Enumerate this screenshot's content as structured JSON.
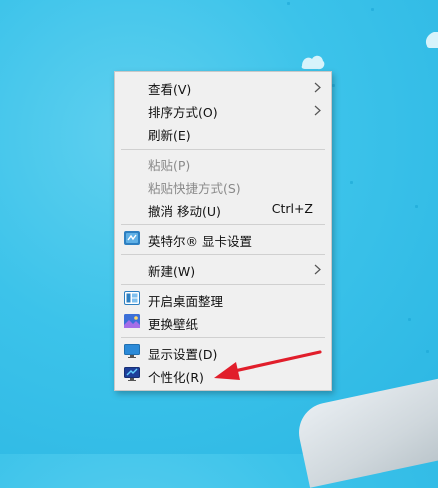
{
  "menu": {
    "view": "查看(V)",
    "sort": "排序方式(O)",
    "refresh": "刷新(E)",
    "paste": "粘贴(P)",
    "paste_shortcut": "粘贴快捷方式(S)",
    "undo_move": "撤消 移动(U)",
    "undo_shortcut": "Ctrl+Z",
    "intel_graphics": "英特尔® 显卡设置",
    "new": "新建(W)",
    "open_desktop_organize": "开启桌面整理",
    "change_wallpaper": "更换壁纸",
    "display_settings": "显示设置(D)",
    "personalize": "个性化(R)"
  },
  "icons": {
    "intel": "intel-graphics-icon",
    "organize": "desktop-organize-icon",
    "wallpaper": "wallpaper-icon",
    "display": "display-settings-icon",
    "personalize": "personalize-icon"
  },
  "colors": {
    "desktop": "#3cc3ea",
    "menu_bg": "#f0f0f0",
    "annotation_arrow": "#e11e2b"
  }
}
